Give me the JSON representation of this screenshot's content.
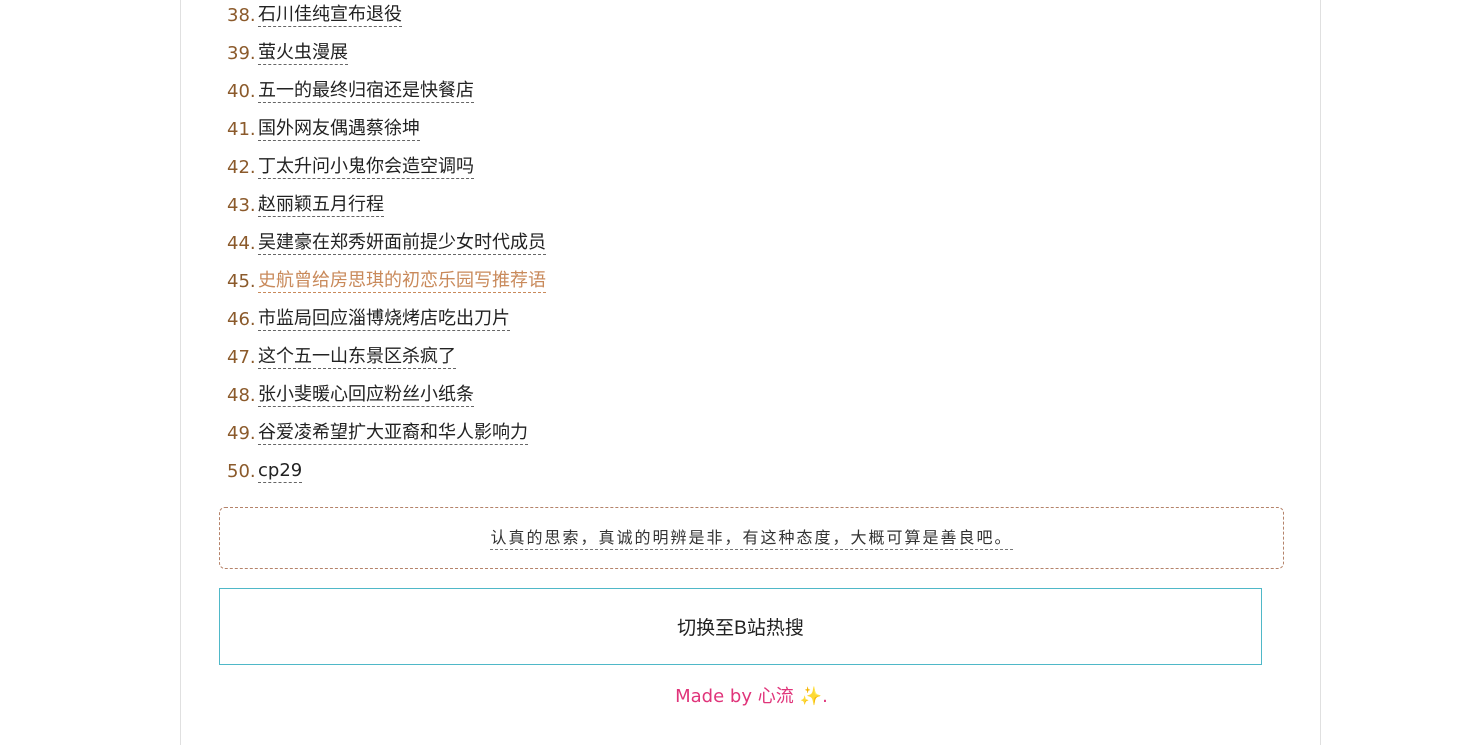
{
  "hot_list": [
    {
      "rank": "38.",
      "title": "石川佳纯宣布退役",
      "visited": false
    },
    {
      "rank": "39.",
      "title": "萤火虫漫展",
      "visited": false
    },
    {
      "rank": "40.",
      "title": "五一的最终归宿还是快餐店",
      "visited": false
    },
    {
      "rank": "41.",
      "title": "国外网友偶遇蔡徐坤",
      "visited": false
    },
    {
      "rank": "42.",
      "title": "丁太升问小鬼你会造空调吗",
      "visited": false
    },
    {
      "rank": "43.",
      "title": "赵丽颖五月行程",
      "visited": false
    },
    {
      "rank": "44.",
      "title": "吴建豪在郑秀妍面前提少女时代成员",
      "visited": false
    },
    {
      "rank": "45.",
      "title": "史航曾给房思琪的初恋乐园写推荐语",
      "visited": true
    },
    {
      "rank": "46.",
      "title": "市监局回应淄博烧烤店吃出刀片",
      "visited": false
    },
    {
      "rank": "47.",
      "title": "这个五一山东景区杀疯了",
      "visited": false
    },
    {
      "rank": "48.",
      "title": "张小斐暖心回应粉丝小纸条",
      "visited": false
    },
    {
      "rank": "49.",
      "title": "谷爱凌希望扩大亚裔和华人影响力",
      "visited": false
    },
    {
      "rank": "50.",
      "title": "cp29",
      "visited": false
    }
  ],
  "quote": {
    "text": "认真的思索，真诚的明辨是非，有这种态度，大概可算是善良吧。"
  },
  "switch_button": {
    "label": "切换至B站热搜"
  },
  "footer": {
    "made_by": "Made by 心流",
    "sparkle": "✨",
    "period": "."
  },
  "colors": {
    "rank_number": "#8b5a2b",
    "visited_link": "#c98a5b",
    "button_border": "#4fb8c8",
    "footer_text": "#e0347a"
  }
}
